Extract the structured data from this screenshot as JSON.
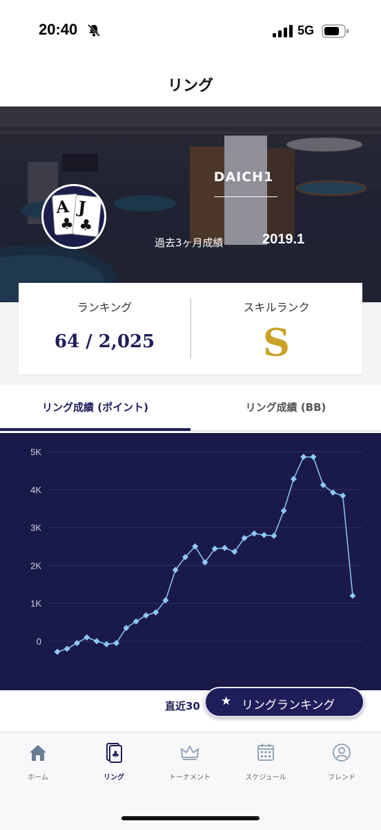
{
  "status_bar": {
    "time": "20:40",
    "network": "5G"
  },
  "header": {
    "title": "リング"
  },
  "profile": {
    "player_name": "DAICH1",
    "period_label": "過去3ヶ月成績",
    "period_value": "2019.1",
    "cards": [
      {
        "rank": "A",
        "suit": "♣"
      },
      {
        "rank": "J",
        "suit": "♣"
      }
    ]
  },
  "stats": {
    "ranking_label": "ランキング",
    "ranking_value": "64 / 2,025",
    "skill_label": "スキルランク",
    "skill_value": "S",
    "accent_color": "#c9a227"
  },
  "tabs": [
    {
      "label": "リング成績 (ポイント)",
      "active": true
    },
    {
      "label": "リング成績 (BB)",
      "active": false
    }
  ],
  "chart_data": {
    "type": "line",
    "ylim": [
      -300,
      5200
    ],
    "y_ticks": [
      "5K",
      "4K",
      "3K",
      "2K",
      "1K",
      "0"
    ],
    "y_tick_values": [
      5000,
      4000,
      3000,
      2000,
      1000,
      0
    ],
    "grid": true,
    "series": [
      {
        "values": [
          -280,
          -200,
          -50,
          100,
          0,
          -80,
          -50,
          350,
          520,
          680,
          760,
          1080,
          1880,
          2220,
          2500,
          2080,
          2440,
          2460,
          2360,
          2720,
          2840,
          2800,
          2780,
          3440,
          4280,
          4860,
          4860,
          4120,
          3920,
          3840,
          1200
        ]
      }
    ],
    "line_color": "#8ec9f5",
    "background": "#1a1a4a"
  },
  "recent_label": "直近30",
  "ranking_button": {
    "icon": "star-icon",
    "label": "リングランキング"
  },
  "bottom_nav": [
    {
      "label": "ホーム",
      "icon": "home-icon",
      "active": false
    },
    {
      "label": "リング",
      "icon": "club-card-icon",
      "active": true
    },
    {
      "label": "トーナメント",
      "icon": "crown-icon",
      "active": false
    },
    {
      "label": "スケジュール",
      "icon": "calendar-icon",
      "active": false
    },
    {
      "label": "フレンド",
      "icon": "person-icon",
      "active": false
    }
  ]
}
